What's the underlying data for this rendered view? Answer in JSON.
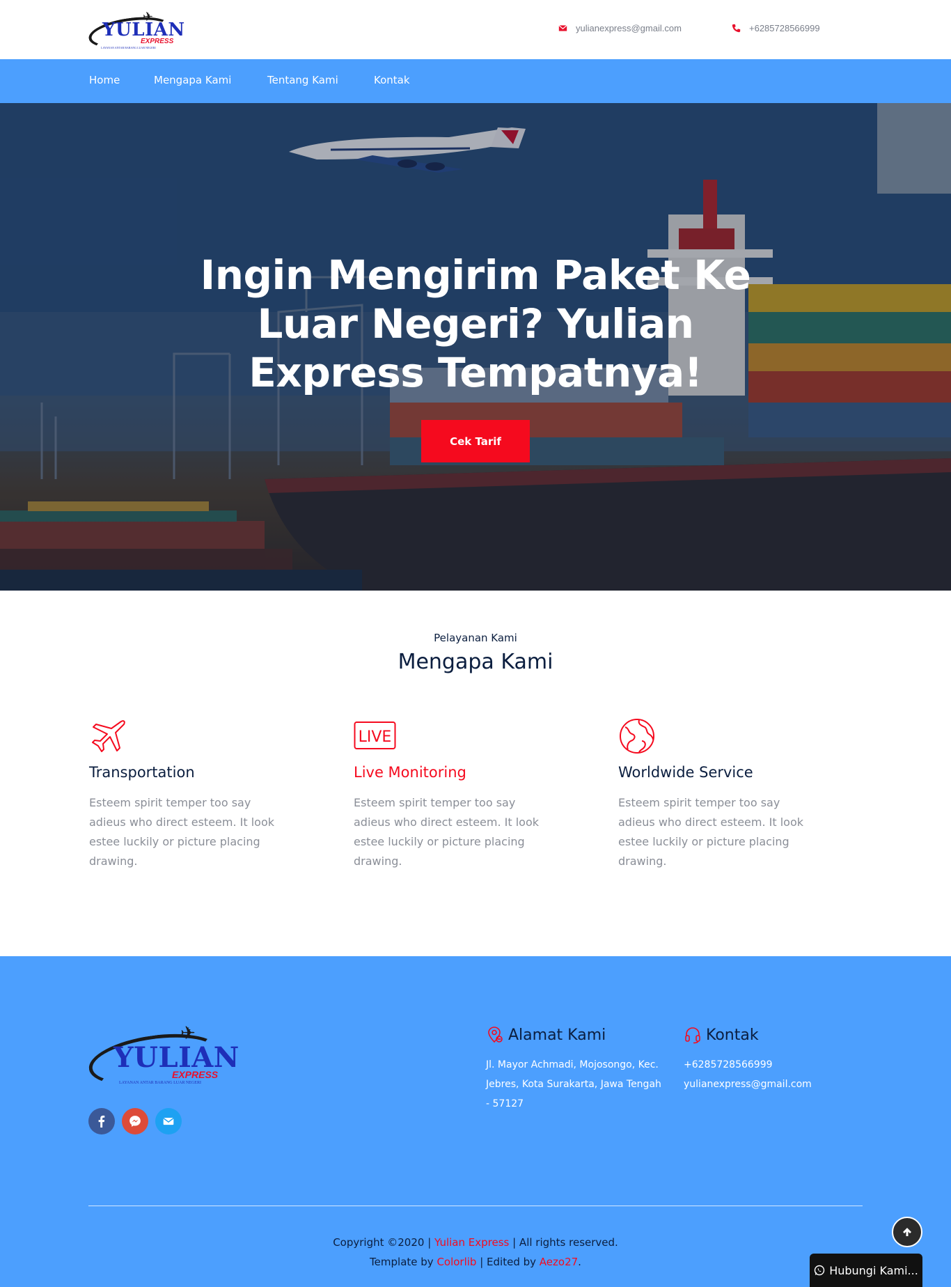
{
  "brand": {
    "name": "YULIAN",
    "sub": "EXPRESS",
    "tagline": "LAYANAN ANTAR BARANG LUAR NEGERI",
    "blue": "#1e2fb8",
    "red": "#e8112d"
  },
  "header": {
    "email": "yulianexpress@gmail.com",
    "phone": "+6285728566999",
    "email_icon": "envelope-icon",
    "phone_icon": "phone-icon"
  },
  "nav": {
    "items": [
      {
        "label": "Home"
      },
      {
        "label": "Mengapa Kami"
      },
      {
        "label": "Tentang Kami"
      },
      {
        "label": "Kontak"
      }
    ]
  },
  "hero": {
    "title": "Ingin Mengirim Paket Ke Luar Negeri? Yulian Express Tempatnya!",
    "button": "Cek Tarif"
  },
  "services": {
    "kicker": "Pelayanan Kami",
    "title": "Mengapa Kami",
    "items": [
      {
        "icon": "airplane-icon",
        "title": "Transportation",
        "desc": "Esteem spirit temper too say adieus who direct esteem. It look estee luckily or picture placing drawing."
      },
      {
        "icon": "live-icon",
        "icon_text": "LIVE",
        "title": "Live Monitoring",
        "desc": "Esteem spirit temper too say adieus who direct esteem. It look estee luckily or picture placing drawing."
      },
      {
        "icon": "globe-icon",
        "title": "Worldwide Service",
        "desc": "Esteem spirit temper too say adieus who direct esteem. It look estee luckily or picture placing drawing."
      }
    ]
  },
  "footer": {
    "socials": [
      {
        "icon": "facebook-icon",
        "color": "#3b5998"
      },
      {
        "icon": "messenger-icon",
        "color": "#dd4b39"
      },
      {
        "icon": "envelope-icon",
        "color": "#1da1f2"
      }
    ],
    "address": {
      "title": "Alamat Kami",
      "icon": "location-pin-icon",
      "text": "Jl. Mayor Achmadi, Mojosongo, Kec. Jebres, Kota Surakarta, Jawa Tengah - 57127"
    },
    "contact": {
      "title": "Kontak",
      "icon": "headset-icon",
      "phone": "+6285728566999",
      "email": "yulianexpress@gmail.com"
    },
    "copyright": {
      "prefix": "Copyright ©2020 | ",
      "brand_link": "Yulian Express",
      "suffix": " | All rights reserved.",
      "template_prefix": "Template by ",
      "template_link": "Colorlib",
      "edited_prefix": " | Edited by ",
      "edited_link": "Aezo27",
      "end": "."
    },
    "whatsapp_button": "Hubungi Kami...",
    "scroll_top_icon": "arrow-up-icon"
  },
  "colors": {
    "primary_blue": "#4c9ffe",
    "accent_red": "#f50a1e",
    "heading": "#0b1e3f",
    "body_text": "#8a8e97"
  }
}
